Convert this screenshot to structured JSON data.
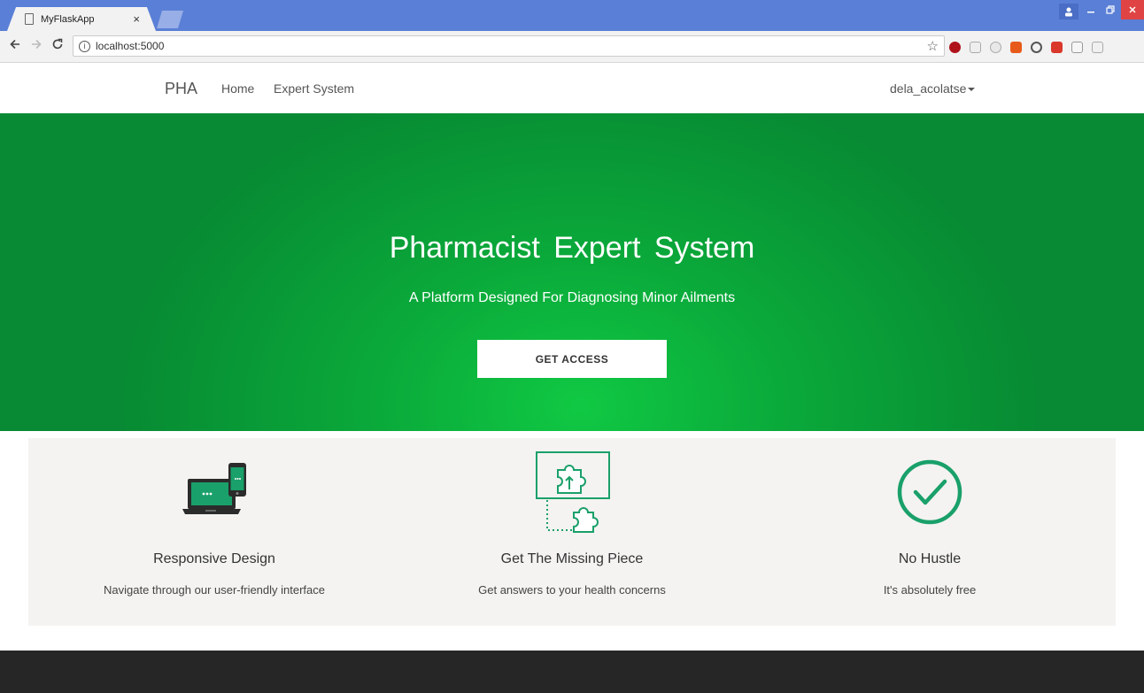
{
  "browser": {
    "tab_title": "MyFlaskApp",
    "tab_close": "×",
    "url": "localhost:5000"
  },
  "navbar": {
    "brand": "PHA",
    "links": [
      "Home",
      "Expert System"
    ],
    "user": "dela_acolatse"
  },
  "hero": {
    "title": "Pharmacist Expert System",
    "subtitle": "A Platform Designed For Diagnosing Minor Ailments",
    "cta_label": "GET ACCESS"
  },
  "features": [
    {
      "icon": "devices-icon",
      "title": "Responsive Design",
      "description": "Navigate through our user-friendly interface"
    },
    {
      "icon": "puzzle-icon",
      "title": "Get The Missing Piece",
      "description": "Get answers to your health concerns"
    },
    {
      "icon": "check-circle-icon",
      "title": "No Hustle",
      "description": "It's absolutely free"
    }
  ],
  "colors": {
    "hero_green": "#0aa93a",
    "icon_green": "#1aa06a",
    "footer": "#262626"
  }
}
